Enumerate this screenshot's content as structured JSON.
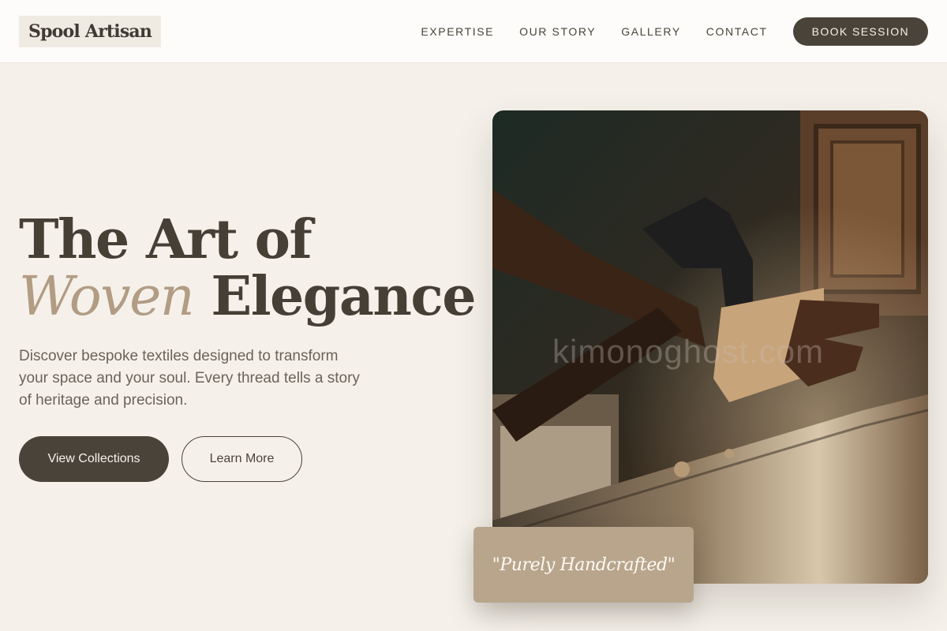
{
  "brand": {
    "name": "Spool Artisan"
  },
  "nav": {
    "links": [
      {
        "label": "EXPERTISE"
      },
      {
        "label": "OUR STORY"
      },
      {
        "label": "GALLERY"
      },
      {
        "label": "CONTACT"
      }
    ],
    "cta_label": "BOOK SESSION"
  },
  "hero": {
    "title_line1": "The Art of",
    "title_accent": "Woven",
    "title_rest": "Elegance",
    "description": "Discover bespoke textiles designed to transform your space and your soul. Every thread tells a story of heritage and precision.",
    "primary_button": "View Collections",
    "secondary_button": "Learn More"
  },
  "image": {
    "subject": "artisan carving wood with an adze",
    "watermark": "kimonoghost.com"
  },
  "badge": {
    "text": "\"Purely Handcrafted\""
  },
  "colors": {
    "background": "#f5f1ea",
    "primary_dark": "#4a433a",
    "accent_tan": "#b29c84",
    "badge_bg": "#b8a58c"
  }
}
